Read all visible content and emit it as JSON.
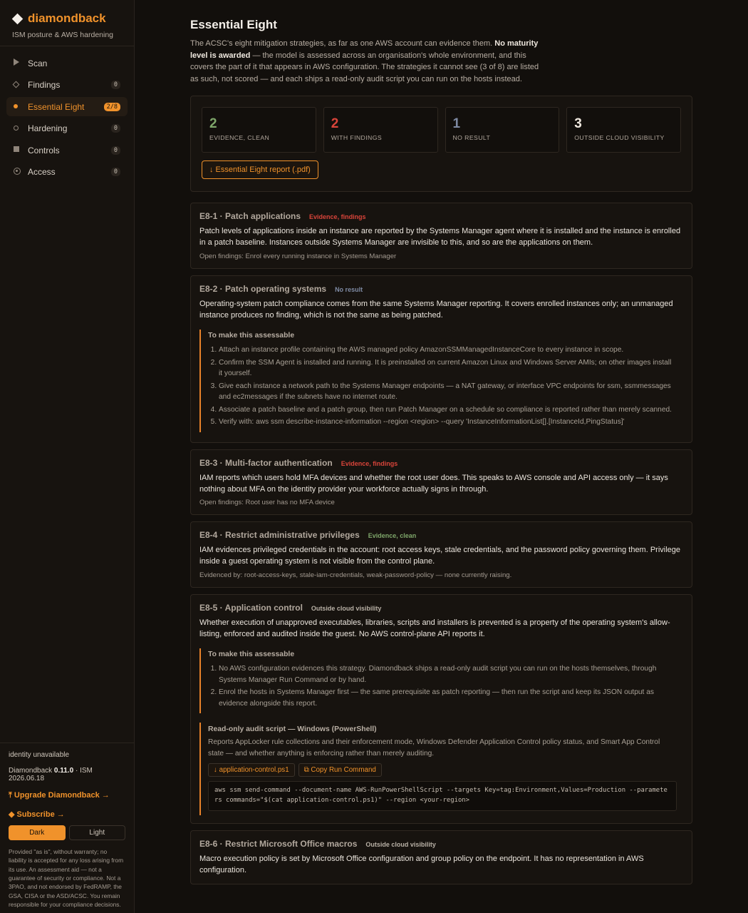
{
  "colors": {
    "accent": "#f0922b",
    "clean": "#7ea66a",
    "findings": "#d9443a",
    "noresult": "#7e8aa3",
    "outside": "#b9b1a6"
  },
  "brand": {
    "name": "diamondback",
    "subtitle": "ISM posture & AWS hardening",
    "icon": "diamond-icon"
  },
  "nav": [
    {
      "label": "Scan",
      "badge": "",
      "icon": "play-icon"
    },
    {
      "label": "Findings",
      "badge": "0",
      "icon": "diamond-outline-icon"
    },
    {
      "label": "Essential Eight",
      "badge": "2/8",
      "icon": "dot-icon",
      "active": true
    },
    {
      "label": "Hardening",
      "badge": "0",
      "icon": "ring-icon"
    },
    {
      "label": "Controls",
      "badge": "0",
      "icon": "square-icon"
    },
    {
      "label": "Access",
      "badge": "0",
      "icon": "target-icon"
    }
  ],
  "footer": {
    "identity": "identity unavailable",
    "version_prefix": "Diamondback ",
    "version": "0.11.0",
    "version_suffix": " · ISM 2026.06.18",
    "upgrade": "⤒ Upgrade Diamondback →",
    "subscribe": "◆ Subscribe →",
    "theme_dark": "Dark",
    "theme_light": "Light",
    "disclaimer": "Provided \"as is\", without warranty; no liability is accepted for any loss arising from its use. An assessment aid — not a guarantee of security or compliance. Not a 3PAO, and not endorsed by FedRAMP, the GSA, CISA or the ASD/ACSC. You remain responsible for your compliance decisions."
  },
  "page": {
    "title": "Essential Eight",
    "intro_a": "The ACSC's eight mitigation strategies, as far as one AWS account can evidence them. ",
    "intro_b": "No maturity level is awarded",
    "intro_c": " — the model is assessed across an organisation's whole environment, and this covers the part of it that appears in AWS configuration. The strategies it cannot see (3 of 8) are listed as such, not scored — and each ships a read-only audit script you can run on the hosts instead."
  },
  "stats": [
    {
      "value": "2",
      "label": "EVIDENCE, CLEAN"
    },
    {
      "value": "2",
      "label": "WITH FINDINGS"
    },
    {
      "value": "1",
      "label": "NO RESULT"
    },
    {
      "value": "3",
      "label": "OUTSIDE CLOUD VISIBILITY"
    }
  ],
  "report_button": "↓ Essential Eight report (.pdf)",
  "cards": {
    "e1": {
      "title": "E8-1 · Patch applications",
      "status": "Evidence, findings",
      "body": "Patch levels of applications inside an instance are reported by the Systems Manager agent where it is installed and the instance is enrolled in a patch baseline. Instances outside Systems Manager are invisible to this, and so are the applications on them.",
      "note": "Open findings: Enrol every running instance in Systems Manager"
    },
    "e2": {
      "title": "E8-2 · Patch operating systems",
      "status": "No result",
      "body": "Operating-system patch compliance comes from the same Systems Manager reporting. It covers enrolled instances only; an unmanaged instance produces no finding, which is not the same as being patched.",
      "assess_title": "To make this assessable",
      "steps": [
        "Attach an instance profile containing the AWS managed policy AmazonSSMManagedInstanceCore to every instance in scope.",
        "Confirm the SSM Agent is installed and running. It is preinstalled on current Amazon Linux and Windows Server AMIs; on other images install it yourself.",
        "Give each instance a network path to the Systems Manager endpoints — a NAT gateway, or interface VPC endpoints for ssm, ssmmessages and ec2messages if the subnets have no internet route.",
        "Associate a patch baseline and a patch group, then run Patch Manager on a schedule so compliance is reported rather than merely scanned.",
        "Verify with: aws ssm describe-instance-information --region <region> --query 'InstanceInformationList[].[InstanceId,PingStatus]'"
      ]
    },
    "e3": {
      "title": "E8-3 · Multi-factor authentication",
      "status": "Evidence, findings",
      "body": "IAM reports which users hold MFA devices and whether the root user does. This speaks to AWS console and API access only — it says nothing about MFA on the identity provider your workforce actually signs in through.",
      "note": "Open findings: Root user has no MFA device"
    },
    "e4": {
      "title": "E8-4 · Restrict administrative privileges",
      "status": "Evidence, clean",
      "body": "IAM evidences privileged credentials in the account: root access keys, stale credentials, and the password policy governing them. Privilege inside a guest operating system is not visible from the control plane.",
      "note": "Evidenced by: root-access-keys, stale-iam-credentials, weak-password-policy — none currently raising."
    },
    "e5": {
      "title": "E8-5 · Application control",
      "status": "Outside cloud visibility",
      "body": "Whether execution of unapproved executables, libraries, scripts and installers is prevented is a property of the operating system's allow-listing, enforced and audited inside the guest. No AWS control-plane API reports it.",
      "assess_title": "To make this assessable",
      "steps": [
        "No AWS configuration evidences this strategy. Diamondback ships a read-only audit script you can run on the hosts themselves, through Systems Manager Run Command or by hand.",
        "Enrol the hosts in Systems Manager first — the same prerequisite as patch reporting — then run the script and keep its JSON output as evidence alongside this report."
      ],
      "script_title": "Read-only audit script — Windows (PowerShell)",
      "script_desc": "Reports AppLocker rule collections and their enforcement mode, Windows Defender Application Control policy status, and Smart App Control state — and whether anything is enforcing rather than merely auditing.",
      "download": "↓ application-control.ps1",
      "copy": "⧉ Copy Run Command",
      "code": "aws ssm send-command --document-name AWS-RunPowerShellScript --targets Key=tag:Environment,Values=Production --parameters commands=\"$(cat application-control.ps1)\" --region <your-region>"
    },
    "e6": {
      "title": "E8-6 · Restrict Microsoft Office macros",
      "status": "Outside cloud visibility",
      "body": "Macro execution policy is set by Microsoft Office configuration and group policy on the endpoint. It has no representation in AWS configuration."
    }
  }
}
